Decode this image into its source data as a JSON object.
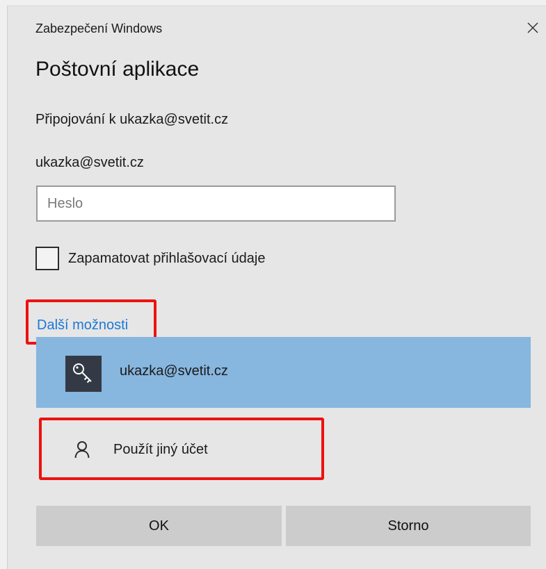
{
  "window": {
    "title": "Zabezpečení Windows",
    "close_icon": "close-icon"
  },
  "dialog": {
    "app_title": "Poštovní aplikace",
    "connecting_text": "Připojování k ukazka@svetit.cz",
    "account_text": "ukazka@svetit.cz",
    "password": {
      "value": "",
      "placeholder": "Heslo"
    },
    "remember": {
      "label": "Zapamatovat přihlašovací údaje",
      "checked": false
    },
    "more_options_label": "Další možnosti"
  },
  "options": {
    "selected_account": {
      "label": "ukazka@svetit.cz",
      "icon": "key-icon"
    },
    "other_account": {
      "label": "Použít jiný účet",
      "icon": "person-icon"
    }
  },
  "buttons": {
    "ok_label": "OK",
    "cancel_label": "Storno"
  },
  "colors": {
    "dialog_background": "#e6e6e6",
    "link": "#1a79d6",
    "selected_item": "#87b6de",
    "highlight_annotation": "#ee1111",
    "button": "#cccccc"
  }
}
